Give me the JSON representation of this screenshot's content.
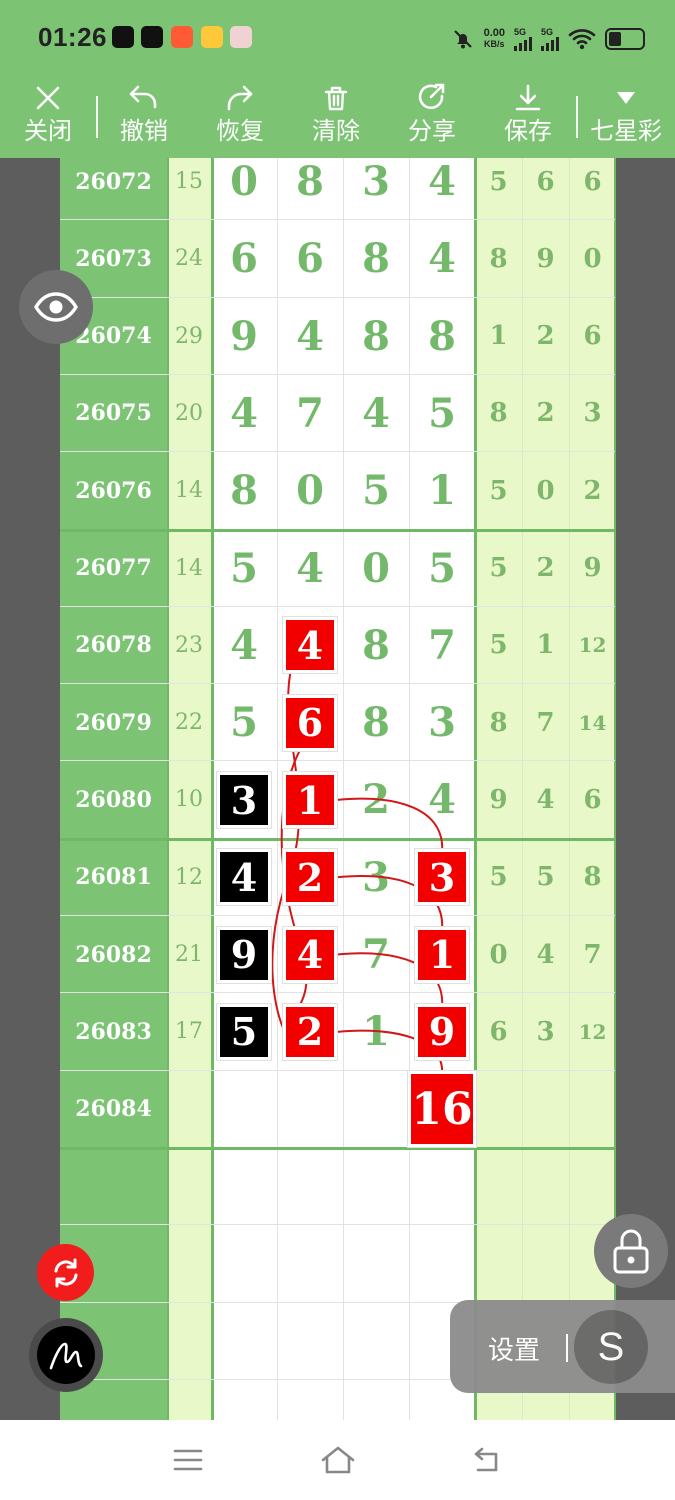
{
  "status_bar": {
    "time": "01:26",
    "net_speed_value": "0.00",
    "net_speed_unit": "KB/s",
    "sim1": "5G",
    "sim2": "5G"
  },
  "toolbar": {
    "close_label": "关闭",
    "undo_label": "撤销",
    "redo_label": "恢复",
    "clear_label": "清除",
    "share_label": "分享",
    "save_label": "保存",
    "lottery_label": "七星彩"
  },
  "chart": {
    "rows": [
      {
        "id": "26072",
        "sum": "15",
        "main": [
          "0",
          "8",
          "3",
          "4"
        ],
        "tail": [
          "5",
          "6",
          "6"
        ]
      },
      {
        "id": "26073",
        "sum": "24",
        "main": [
          "6",
          "6",
          "8",
          "4"
        ],
        "tail": [
          "8",
          "9",
          "0"
        ]
      },
      {
        "id": "26074",
        "sum": "29",
        "main": [
          "9",
          "4",
          "8",
          "8"
        ],
        "tail": [
          "1",
          "2",
          "6"
        ]
      },
      {
        "id": "26075",
        "sum": "20",
        "main": [
          "4",
          "7",
          "4",
          "5"
        ],
        "tail": [
          "8",
          "2",
          "3"
        ]
      },
      {
        "id": "26076",
        "sum": "14",
        "main": [
          "8",
          "0",
          "5",
          "1"
        ],
        "tail": [
          "5",
          "0",
          "2"
        ]
      },
      {
        "id": "26077",
        "sum": "14",
        "main": [
          "5",
          "4",
          "0",
          "5"
        ],
        "tail": [
          "5",
          "2",
          "9"
        ]
      },
      {
        "id": "26078",
        "sum": "23",
        "main": [
          "4",
          "4",
          "8",
          "7"
        ],
        "tail": [
          "5",
          "1",
          "12"
        ]
      },
      {
        "id": "26079",
        "sum": "22",
        "main": [
          "5",
          "6",
          "8",
          "3"
        ],
        "tail": [
          "8",
          "7",
          "14"
        ]
      },
      {
        "id": "26080",
        "sum": "10",
        "main": [
          "3",
          "1",
          "2",
          "4"
        ],
        "tail": [
          "9",
          "4",
          "6"
        ]
      },
      {
        "id": "26081",
        "sum": "12",
        "main": [
          "4",
          "2",
          "3",
          "3"
        ],
        "tail": [
          "5",
          "5",
          "8"
        ]
      },
      {
        "id": "26082",
        "sum": "21",
        "main": [
          "9",
          "4",
          "7",
          "1"
        ],
        "tail": [
          "0",
          "4",
          "7"
        ]
      },
      {
        "id": "26083",
        "sum": "17",
        "main": [
          "5",
          "2",
          "1",
          "9"
        ],
        "tail": [
          "6",
          "3",
          "12"
        ]
      },
      {
        "id": "26084",
        "sum": "",
        "main": [
          "",
          "",
          "",
          "16"
        ],
        "tail": [
          "",
          "",
          ""
        ]
      }
    ],
    "highlights": {
      "red": [
        [
          6,
          1
        ],
        [
          7,
          1
        ],
        [
          8,
          1
        ],
        [
          9,
          1
        ],
        [
          10,
          1
        ],
        [
          11,
          1
        ],
        [
          9,
          3
        ],
        [
          10,
          3
        ],
        [
          11,
          3
        ],
        [
          12,
          3
        ]
      ],
      "black": [
        [
          8,
          0
        ],
        [
          9,
          0
        ],
        [
          10,
          0
        ],
        [
          11,
          0
        ]
      ]
    },
    "colors": {
      "red": "#f20000",
      "black": "#000000",
      "accent": "#7cc374"
    }
  },
  "floating": {
    "settings_label": "设置",
    "s_label": "S"
  }
}
